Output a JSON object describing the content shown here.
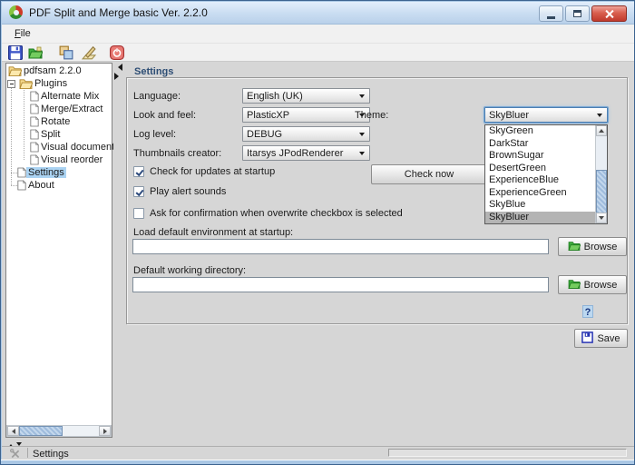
{
  "window": {
    "title": "PDF Split and Merge basic Ver. 2.2.0"
  },
  "menu": {
    "file_label": "File"
  },
  "toolbar": {
    "icons": [
      "save-environment-icon",
      "load-environment-icon",
      "organize-windows-icon",
      "clear-log-icon",
      "exit-icon"
    ]
  },
  "tree": {
    "root": "pdfsam 2.2.0",
    "plugins": "Plugins",
    "plugin_items": [
      "Alternate Mix",
      "Merge/Extract",
      "Rotate",
      "Split",
      "Visual document",
      "Visual reorder"
    ],
    "settings": "Settings",
    "about": "About",
    "selected_item": "Settings"
  },
  "settings_panel": {
    "group_title": "Settings",
    "language_label": "Language:",
    "language_value": "English (UK)",
    "look_and_feel_label": "Look and feel:",
    "look_and_feel_value": "PlasticXP",
    "theme_label": "Theme:",
    "theme_value": "SkyBluer",
    "theme_options": [
      "SkyGreen",
      "DarkStar",
      "BrownSugar",
      "DesertGreen",
      "ExperienceBlue",
      "ExperienceGreen",
      "SkyBlue",
      "SkyBluer"
    ],
    "theme_selected": "SkyBluer",
    "log_level_label": "Log level:",
    "log_level_value": "DEBUG",
    "thumbnails_label": "Thumbnails creator:",
    "thumbnails_value": "Itarsys JPodRenderer",
    "check_updates_label": "Check for updates at startup",
    "check_updates_checked": true,
    "check_now_label": "Check now",
    "play_sounds_label": "Play alert sounds",
    "play_sounds_checked": true,
    "overwrite_confirm_label": "Ask for confirmation when overwrite checkbox is selected",
    "overwrite_confirm_checked": false,
    "load_env_label": "Load default environment at startup:",
    "load_env_value": "",
    "browse_label": "Browse",
    "working_dir_label": "Default working directory:",
    "working_dir_value": "",
    "help_label": "?",
    "save_label": "Save"
  },
  "statusbar": {
    "text": "Settings"
  }
}
